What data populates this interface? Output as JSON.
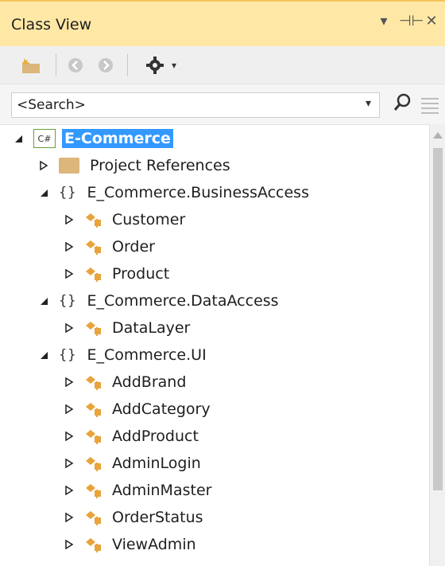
{
  "window": {
    "title": "Class View",
    "controls": [
      "▾",
      "⊣⊢",
      "✕"
    ]
  },
  "toolbar": {
    "new_folder": "new-folder-icon",
    "back": "back-icon",
    "forward": "forward-icon",
    "settings": "settings-icon"
  },
  "search": {
    "value": "<Search>"
  },
  "tree": {
    "root": {
      "label": "E-Commerce",
      "badge": "C#"
    },
    "project_references": "Project References",
    "namespaces": [
      {
        "name": "E_Commerce.BusinessAccess",
        "classes": [
          "Customer",
          "Order",
          "Product"
        ]
      },
      {
        "name": "E_Commerce.DataAccess",
        "classes": [
          "DataLayer"
        ]
      },
      {
        "name": "E_Commerce.UI",
        "classes": [
          "AddBrand",
          "AddCategory",
          "AddProduct",
          "AdminLogin",
          "AdminMaster",
          "OrderStatus",
          "ViewAdmin"
        ]
      }
    ]
  },
  "colors": {
    "title_bg": "#ffe8a6",
    "selection": "#3399ff",
    "class_icon": "#e8a33b"
  }
}
